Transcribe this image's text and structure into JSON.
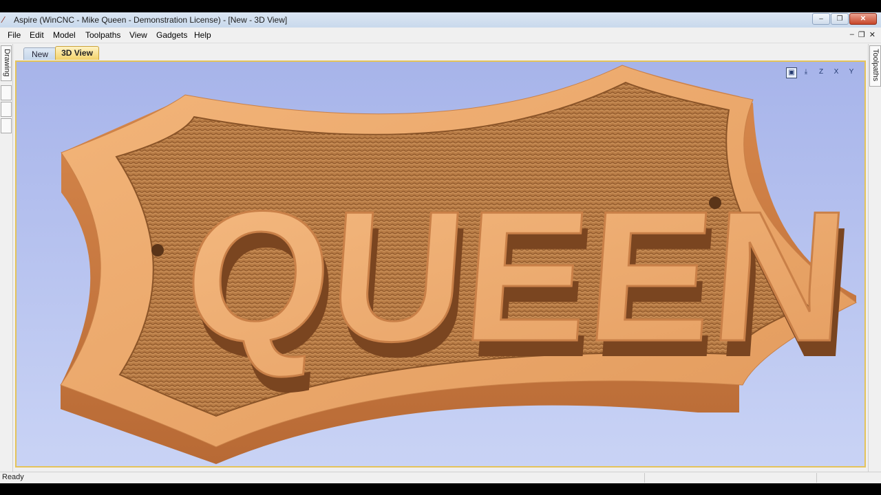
{
  "window": {
    "title": "Aspire (WinCNC - Mike Queen - Demonstration License) - [New - 3D View]",
    "min_glyph": "–",
    "max_glyph": "❐",
    "close_glyph": "✕"
  },
  "menu": [
    {
      "label": "File"
    },
    {
      "label": "Edit"
    },
    {
      "label": "Model"
    },
    {
      "label": "Toolpaths"
    },
    {
      "label": "View"
    },
    {
      "label": "Gadgets"
    },
    {
      "label": "Help"
    }
  ],
  "mdi_controls": {
    "min": "–",
    "restore": "❐",
    "close": "✕"
  },
  "tabs": [
    {
      "label": "New",
      "active": false
    },
    {
      "label": "3D View",
      "active": true
    }
  ],
  "side_tabs": {
    "left": "Drawing",
    "right": "Toolpaths"
  },
  "view_tools": [
    {
      "icon": "zoom-extents-icon"
    },
    {
      "icon": "iso-view-icon"
    },
    {
      "icon": "view-z-icon"
    },
    {
      "icon": "view-x-icon"
    },
    {
      "icon": "view-y-icon"
    }
  ],
  "model": {
    "carved_text": "QUEEN",
    "material_color": "#e9a66b",
    "background_top": "#a7b4ea",
    "background_bottom": "#c9d3f5"
  },
  "status": {
    "text": "Ready"
  }
}
